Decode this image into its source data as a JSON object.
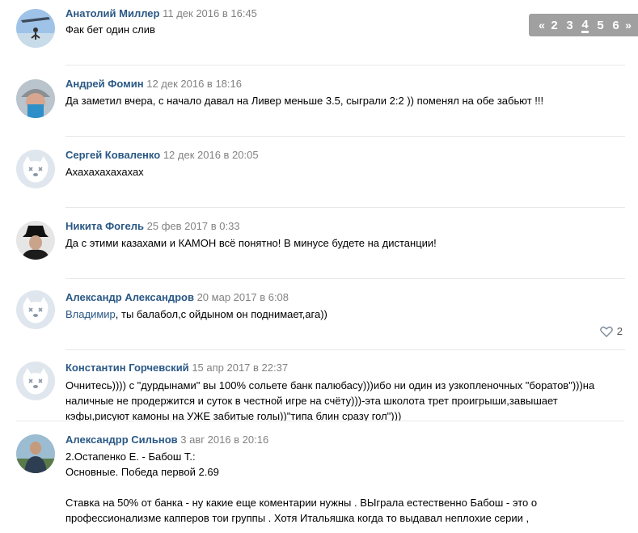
{
  "pagination": {
    "prev": "«",
    "pages": [
      "2",
      "3",
      "4",
      "5",
      "6"
    ],
    "current": "4",
    "next": "»"
  },
  "comments": [
    {
      "author": "Анатолий Миллер",
      "date": "11 дек 2016 в 16:45",
      "lines": [
        "Фак бет один слив"
      ],
      "avatar": "photo-skydiver"
    },
    {
      "author": "Андрей Фомин",
      "date": "12 дек 2016 в 18:16",
      "lines": [
        "Да заметил вчера, с начало давал на Ливер меньше 3.5, сыграли 2:2 )) поменял на обе забьют !!!"
      ],
      "avatar": "photo-winter-hat"
    },
    {
      "author": "Сергей Коваленко",
      "date": "12 дек 2016 в 20:05",
      "lines": [
        "Ахахахахахахах"
      ],
      "avatar": "deactivated-dog"
    },
    {
      "author": "Никита Фогель",
      "date": "25 фев 2017 в 0:33",
      "lines": [
        "Да с этими казахами и КАМОН всё понятно! В минусе будете на дистанции!"
      ],
      "avatar": "photo-black-hat"
    },
    {
      "author": "Александр Александров",
      "date": "20 мар 2017 в 6:08",
      "mention": "Владимир",
      "text_after_mention": ", ты балабол,с ойдыном он поднимает,ага))",
      "likes": "2",
      "avatar": "deactivated-dog"
    },
    {
      "author": "Константин Горчевский",
      "date": "15 апр 2017 в 22:37",
      "lines": [
        "Очнитесь)))) с \"дурдынами\" вы 100% сольете банк палюбасу)))ибо ни один из узкопленочных \"боратов\")))на",
        "наличные не продержится и суток в честной игре на счёту)))-эта школота трет проигрыши,завышает",
        "кэфы,рисуют камоны на УЖЕ забитые голы))\"типа блин сразу гол\")))"
      ],
      "avatar": "deactivated-dog"
    },
    {
      "author": "Александрр Сильнов",
      "date": "3 авг 2016 в 20:16",
      "lines": [
        "2.Остапенко Е. - Бабош Т.:",
        "Основные. Победа первой 2.69",
        "",
        "Ставка на 50% от банка - ну какие еще коментарии нужны . ВЫграла естественно Бабош - это о",
        "профессионализме капперов тои группы . Хотя Итальяшка когда то выдавал неплохие серии ,"
      ],
      "avatar": "photo-man-outdoor"
    }
  ]
}
